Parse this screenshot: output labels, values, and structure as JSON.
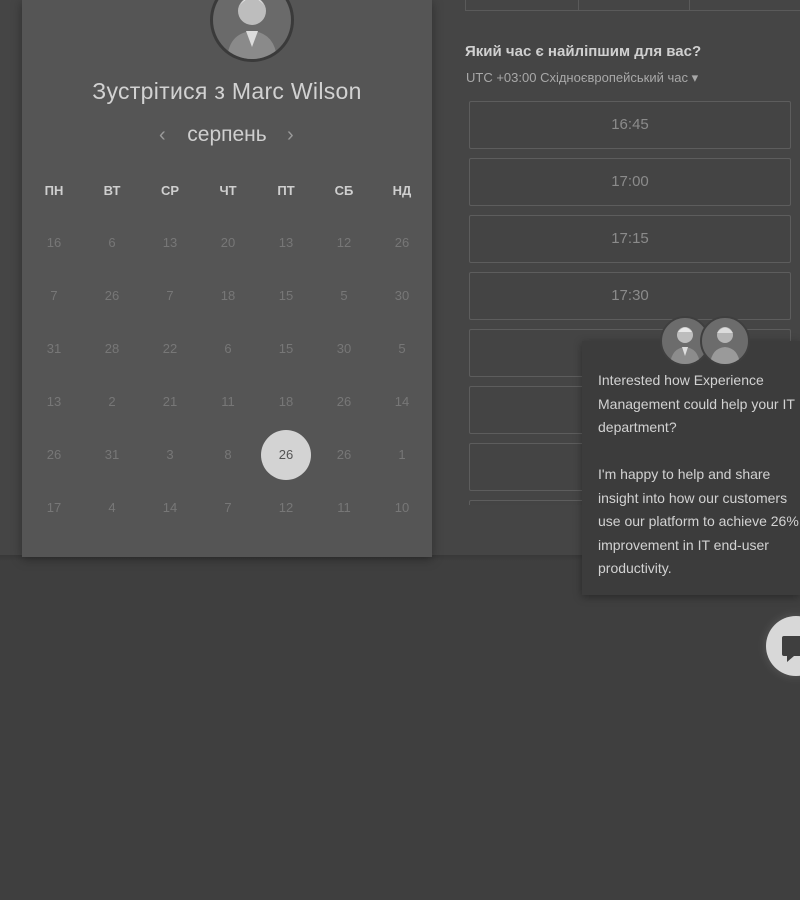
{
  "booking": {
    "title": "Зустрітися з Marc Wilson",
    "month": "серпень",
    "prev_icon": "‹",
    "next_icon": "›",
    "weekdays": [
      "ПН",
      "ВТ",
      "СР",
      "ЧТ",
      "ПТ",
      "СБ",
      "НД"
    ],
    "weeks": [
      [
        "16",
        "6",
        "13",
        "20",
        "13",
        "12",
        "26"
      ],
      [
        "7",
        "26",
        "7",
        "18",
        "15",
        "5",
        "30"
      ],
      [
        "31",
        "28",
        "22",
        "6",
        "15",
        "30",
        "5"
      ],
      [
        "13",
        "2",
        "21",
        "11",
        "18",
        "26",
        "14"
      ],
      [
        "26",
        "31",
        "3",
        "8",
        "26",
        "26",
        "1"
      ],
      [
        "17",
        "4",
        "14",
        "7",
        "12",
        "11",
        "10"
      ]
    ],
    "selected_day": "26"
  },
  "time_panel": {
    "question": "Який час є найліпшим для вас?",
    "timezone": "UTC +03:00 Східноєвропейський час ▾",
    "slots": [
      "16:45",
      "17:00",
      "17:15",
      "17:30",
      "",
      "",
      "",
      ""
    ]
  },
  "chat": {
    "message": "Interested how Experience Management could help your IT department?\n\nI'm happy to help and share insight into how our customers use our platform to achieve 26% improvement in IT end-user productivity."
  },
  "colors": {
    "background": "#3f3f3f",
    "card": "#555555",
    "selected_day": "#d3d3d3"
  }
}
